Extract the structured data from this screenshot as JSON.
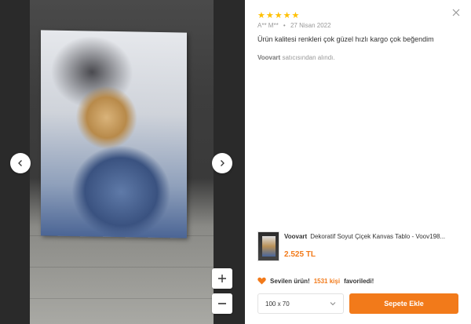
{
  "review": {
    "rating": 5,
    "stars": [
      "★",
      "★",
      "★",
      "★",
      "★"
    ],
    "author": "A** M**",
    "separator": "•",
    "date": "27 Nisan 2022",
    "text": "Ürün kalitesi renkleri çok güzel hızlı kargo çok beğendim",
    "seller_name": "Voovart",
    "seller_suffix": "satıcısından alındı."
  },
  "product": {
    "brand": "Voovart",
    "title": "Dekoratif Soyut Çiçek Kanvas Tablo - Voov198...",
    "price": "2.525 TL"
  },
  "favorite": {
    "label": "Sevilen ürün!",
    "count": "1531 kişi",
    "suffix": "favoriledi!"
  },
  "variant": {
    "selected": "100 x 70"
  },
  "actions": {
    "add_to_cart": "Sepete Ekle"
  },
  "colors": {
    "accent": "#f27a1a",
    "star": "#ffc000"
  },
  "icons": {
    "prev": "chevron-left-icon",
    "next": "chevron-right-icon",
    "zoom_in": "plus-icon",
    "zoom_out": "minus-icon",
    "close": "close-icon",
    "heart": "heart-icon",
    "dropdown": "chevron-down-icon"
  }
}
